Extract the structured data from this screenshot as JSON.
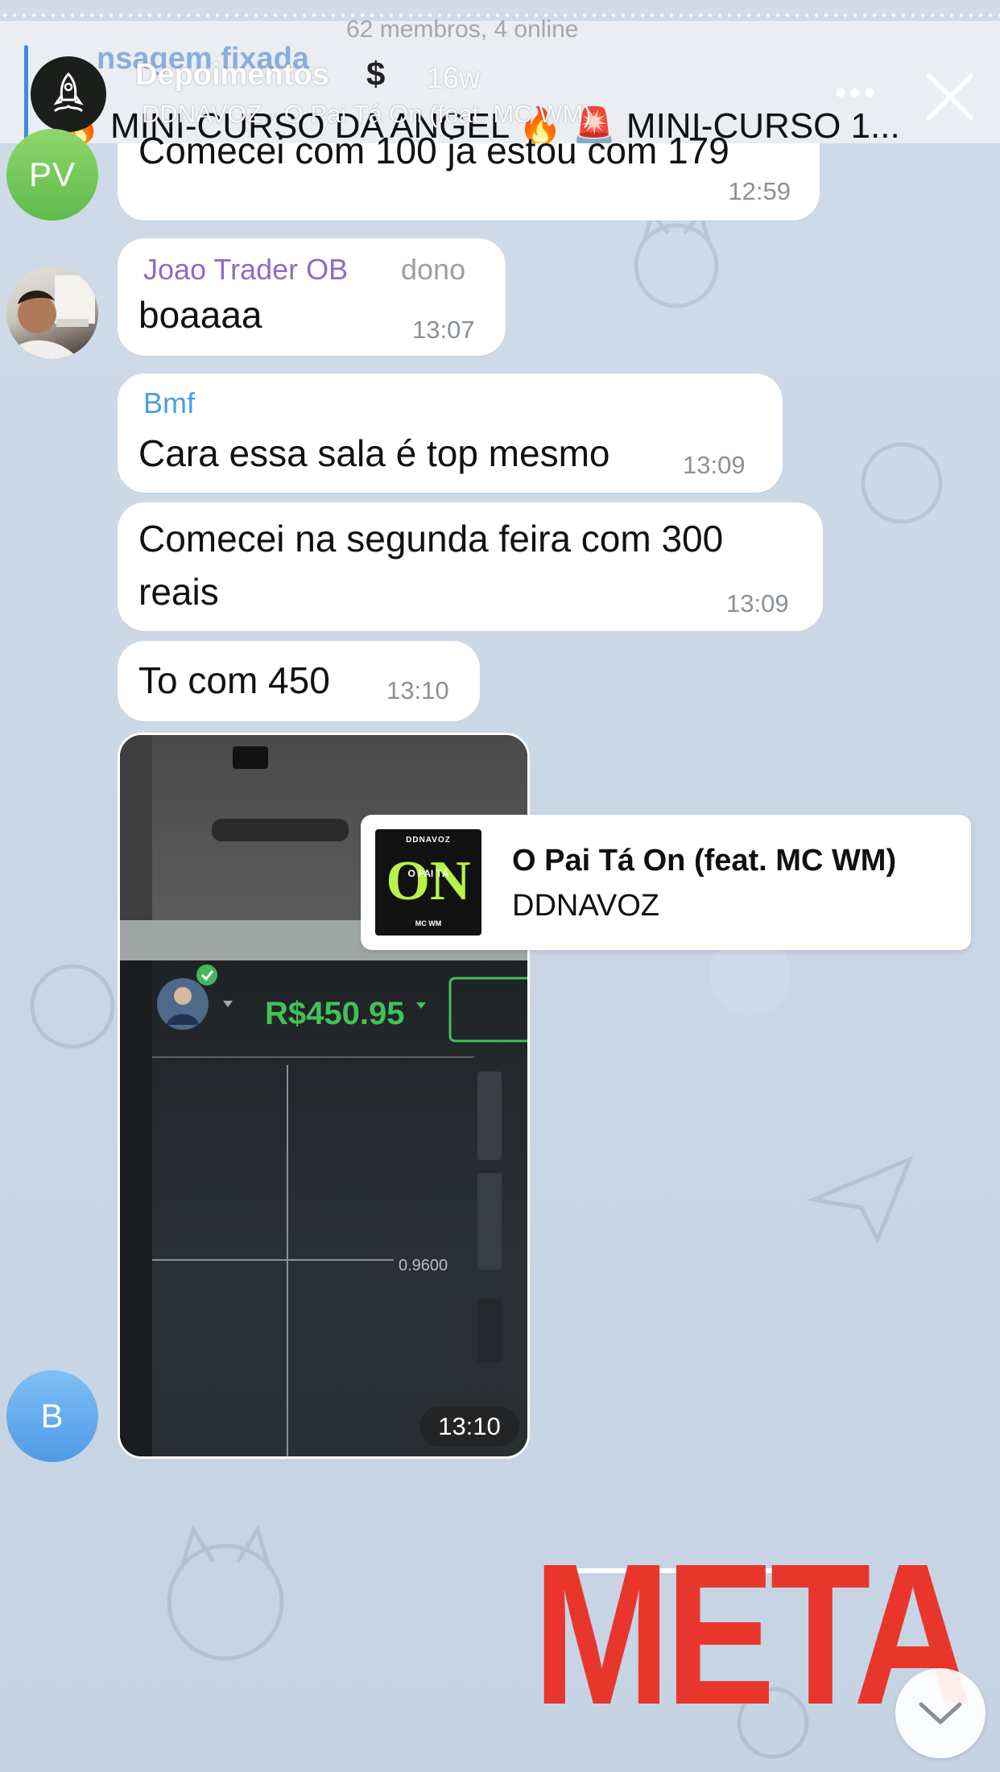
{
  "story": {
    "title": "Depoimentos",
    "dollar": "$",
    "time_ago": "16w",
    "music_line": "DDNAVOZ · O Pai Tá On (feat. MC WM)",
    "header_ghost": "62 membros, 4 online",
    "header_ghost_name": "nsagem fixada"
  },
  "pinned": {
    "text": "🔥 MINI-CURSO DA ANGEL 🔥 🚨 MINI-CURSO 1..."
  },
  "messages": [
    {
      "text": "Comecei com 100 ja estou com 179",
      "time": "12:59"
    },
    {
      "sender": "Joao Trader OB",
      "role": "dono",
      "text": "boaaaa",
      "time": "13:07"
    },
    {
      "sender": "Bmf",
      "text": "Cara essa sala é top mesmo",
      "time": "13:09"
    },
    {
      "line1": "Comecei na segunda feira com 300",
      "line2": "reais",
      "time": "13:09"
    },
    {
      "text": "To com 450",
      "time": "13:10"
    }
  ],
  "avatars": {
    "pv": "PV",
    "b": "B"
  },
  "photo": {
    "balance": "R$450.95",
    "price_line": "0.9600",
    "time": "13:10"
  },
  "music_card": {
    "title": "O Pai Tá On (feat. MC WM)",
    "artist": "DDNAVOZ",
    "album_top": "DDNAVOZ",
    "album_main": "ON",
    "album_mid": "O PAI TÁ",
    "album_bottom": "MC WM"
  },
  "sticker": {
    "text": "META"
  },
  "colors": {
    "name_joao": "#8e6bc8",
    "name_bmf": "#4a9fe0",
    "balance_green": "#43c157",
    "meta_red": "#e8362d"
  }
}
